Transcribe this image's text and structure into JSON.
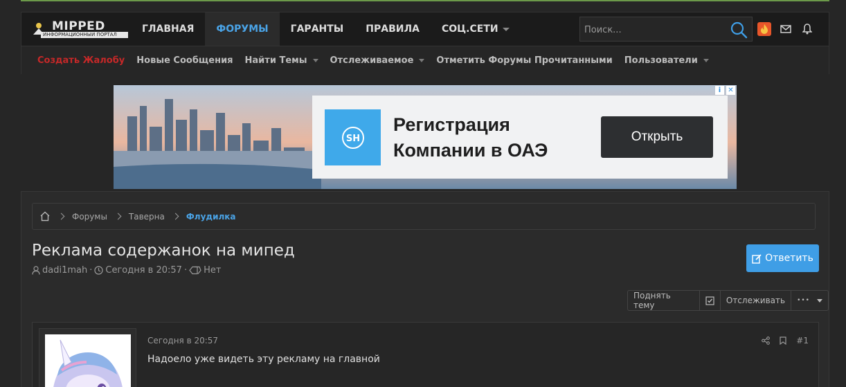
{
  "header": {
    "logo_word": "MIPPED",
    "logo_tag": "ИНФОРМАЦИОННЫЙ ПОРТАЛ",
    "nav": [
      {
        "label": "ГЛАВНАЯ"
      },
      {
        "label": "ФОРУМЫ"
      },
      {
        "label": "ГАРАНТЫ"
      },
      {
        "label": "ПРАВИЛА"
      },
      {
        "label": "СОЦ.СЕТИ"
      }
    ],
    "search_placeholder": "Поиск..."
  },
  "subnav": {
    "items": [
      {
        "label": "Создать Жалобу"
      },
      {
        "label": "Новые Сообщения"
      },
      {
        "label": "Найти Темы"
      },
      {
        "label": "Отслеживаемое"
      },
      {
        "label": "Отметить Форумы Прочитанными"
      },
      {
        "label": "Пользователи"
      }
    ]
  },
  "ad": {
    "headline_line1": "Регистрация",
    "headline_line2": "Компании в ОАЭ",
    "cta": "Открыть",
    "brand_mark": "SH"
  },
  "breadcrumb": {
    "items": [
      "Форумы",
      "Таверна",
      "Флудилка"
    ]
  },
  "thread": {
    "title": "Реклама содержанок на мипед",
    "author": "dadi1mah",
    "time": "Сегодня в 20:57",
    "tags": "Нет",
    "reply_label": "Ответить",
    "bump_label": "Поднять тему",
    "watch_label": "Отслеживать",
    "more_label": "•••"
  },
  "post": {
    "date": "Сегодня в 20:57",
    "text": "Надоело уже видеть эту рекламу на главной",
    "number": "#1"
  },
  "colors": {
    "accent": "#3f9ee6",
    "active_nav": "#4aa3e6",
    "complaint": "#c62828"
  }
}
